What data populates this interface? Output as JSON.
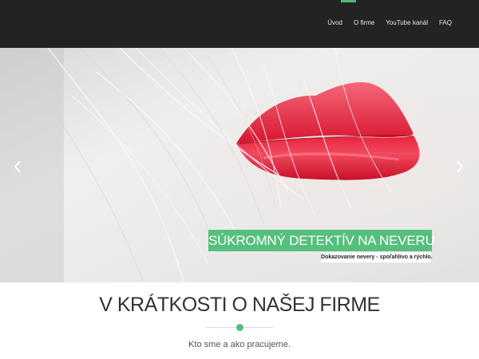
{
  "nav": {
    "items": [
      {
        "label": "Úvod"
      },
      {
        "label": "O firme"
      },
      {
        "label": "YouTube kanál"
      },
      {
        "label": "FAQ"
      }
    ],
    "active_index": 0,
    "accent_color": "#4cbb74"
  },
  "hero": {
    "image_subject": "close-up of red lips with blonde hair strands",
    "caption_title": "SÚKROMNÝ DETEKTÍV NA NEVERU",
    "caption_subtitle": "Dokazovanie nevery - spoľahlivo a rýchlo.",
    "prev_icon": "chevron-left-icon",
    "next_icon": "chevron-right-icon"
  },
  "intro": {
    "title": "V KRÁTKOSTI O NAŠEJ FIRME",
    "subtitle": "Kto sme a ako pracujeme."
  }
}
